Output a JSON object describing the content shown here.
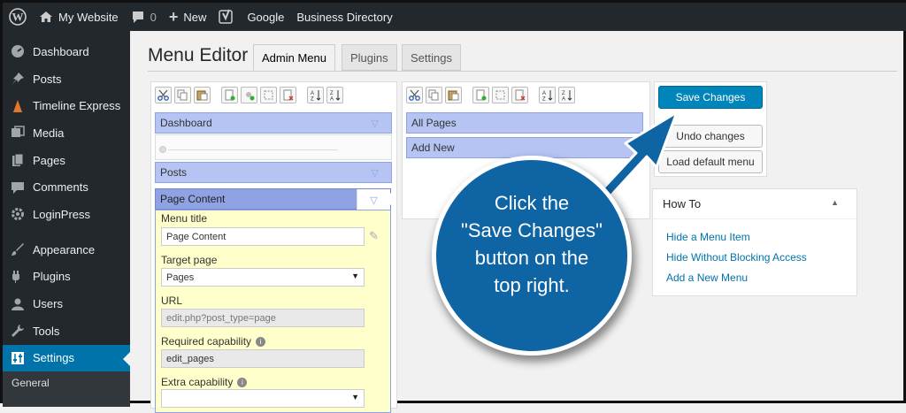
{
  "adminbar": {
    "site_name": "My Website",
    "comments_count": "0",
    "new_label": "New",
    "google_label": "Google",
    "directory_label": "Business Directory"
  },
  "sidebar": {
    "items": [
      {
        "label": "Dashboard",
        "icon": "dashboard-icon"
      },
      {
        "label": "Posts",
        "icon": "pin-icon"
      },
      {
        "label": "Timeline Express",
        "icon": "timeline-icon"
      },
      {
        "label": "Media",
        "icon": "media-icon"
      },
      {
        "label": "Pages",
        "icon": "pages-icon"
      },
      {
        "label": "Comments",
        "icon": "comments-icon"
      },
      {
        "label": "LoginPress",
        "icon": "gear-icon"
      },
      {
        "label": "Appearance",
        "icon": "brush-icon"
      },
      {
        "label": "Plugins",
        "icon": "plugin-icon"
      },
      {
        "label": "Users",
        "icon": "user-icon"
      },
      {
        "label": "Tools",
        "icon": "wrench-icon"
      },
      {
        "label": "Settings",
        "icon": "settings-icon"
      }
    ],
    "submenu_label": "General"
  },
  "page": {
    "title": "Menu Editor",
    "tabs": [
      "Admin Menu",
      "Plugins",
      "Settings"
    ]
  },
  "left_menu": {
    "items": [
      "Dashboard",
      "Posts",
      "Page Content"
    ]
  },
  "editor": {
    "menu_title_label": "Menu title",
    "menu_title_value": "Page Content",
    "target_page_label": "Target page",
    "target_page_value": "Pages",
    "url_label": "URL",
    "url_value": "edit.php?post_type=page",
    "required_cap_label": "Required capability",
    "required_cap_value": "edit_pages",
    "extra_cap_label": "Extra capability"
  },
  "right_menu": {
    "items": [
      "All Pages",
      "Add New"
    ]
  },
  "actions": {
    "save": "Save Changes",
    "undo": "Undo changes",
    "load_default": "Load default menu"
  },
  "howto": {
    "title": "How To",
    "links": [
      "Hide a Menu Item",
      "Hide Without Blocking Access",
      "Add a New Menu"
    ]
  },
  "callout": {
    "lines": [
      "Click the",
      "\"Save Changes\"",
      "button on the",
      "top right."
    ]
  },
  "colors": {
    "adminbar": "#23282d",
    "accent": "#0073aa",
    "menu_item": "#b6c4f3",
    "callout": "#0f64a4"
  }
}
